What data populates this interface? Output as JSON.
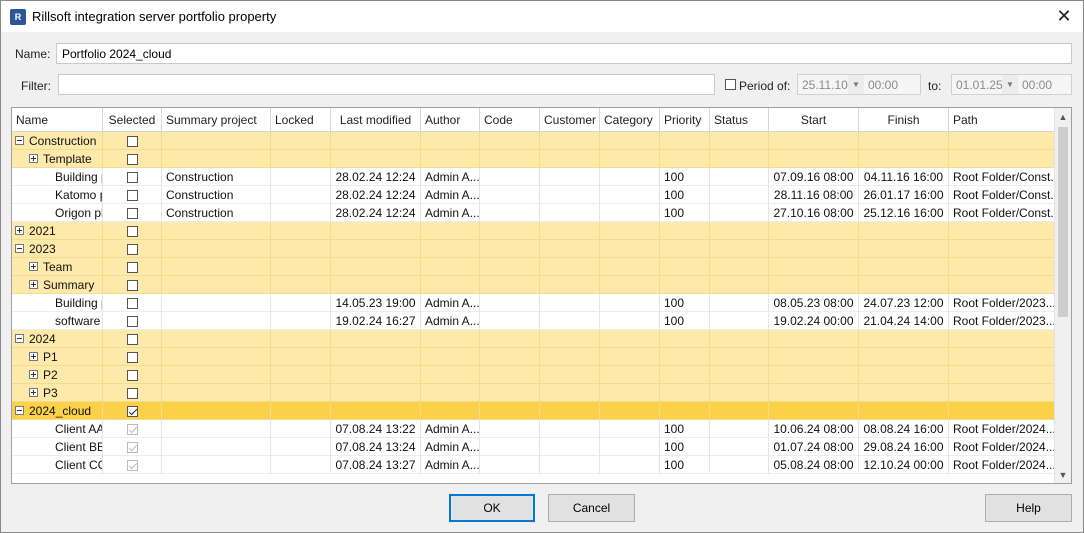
{
  "window": {
    "app_icon_text": "R",
    "title": "Rillsoft integration server portfolio property",
    "close_glyph": "✕"
  },
  "form": {
    "name_label": "Name:",
    "name_value": "Portfolio 2024_cloud",
    "filter_label": "Filter:",
    "filter_value": "",
    "period_label": "Period of:",
    "period_checked": false,
    "from_date": "25.11.10",
    "from_time": "00:00",
    "to_label": "to:",
    "to_date": "01.01.25",
    "to_time": "00:00"
  },
  "grid": {
    "columns": [
      "Name",
      "Selected",
      "Summary project",
      "Locked",
      "Last modified",
      "Author",
      "Code",
      "Customer",
      "Category",
      "Priority",
      "Status",
      "Start",
      "Finish",
      "Path"
    ],
    "rows": [
      {
        "type": "group",
        "level": 0,
        "expander": "minus",
        "name": "Construction",
        "checked": false,
        "disabled": false,
        "summary": "",
        "modified": "",
        "author": "",
        "priority": "",
        "start": "",
        "finish": "",
        "path": ""
      },
      {
        "type": "group",
        "level": 1,
        "expander": "plus",
        "name": "Template",
        "checked": false,
        "disabled": false,
        "summary": "",
        "modified": "",
        "author": "",
        "priority": "",
        "start": "",
        "finish": "",
        "path": ""
      },
      {
        "type": "plain",
        "level": 2,
        "expander": "",
        "name": "Building p",
        "checked": false,
        "disabled": false,
        "summary": "Construction",
        "modified": "28.02.24 12:24",
        "author": "Admin A...",
        "priority": "100",
        "start": "07.09.16 08:00",
        "finish": "04.11.16 16:00",
        "path": "Root Folder/Const..."
      },
      {
        "type": "plain",
        "level": 2,
        "expander": "",
        "name": "Katomo p",
        "checked": false,
        "disabled": false,
        "summary": "Construction",
        "modified": "28.02.24 12:24",
        "author": "Admin A...",
        "priority": "100",
        "start": "28.11.16 08:00",
        "finish": "26.01.17 16:00",
        "path": "Root Folder/Const..."
      },
      {
        "type": "plain",
        "level": 2,
        "expander": "",
        "name": "Origon pl",
        "checked": false,
        "disabled": false,
        "summary": "Construction",
        "modified": "28.02.24 12:24",
        "author": "Admin A...",
        "priority": "100",
        "start": "27.10.16 08:00",
        "finish": "25.12.16 16:00",
        "path": "Root Folder/Const..."
      },
      {
        "type": "group",
        "level": 0,
        "expander": "plus",
        "name": "2021",
        "checked": false,
        "disabled": false,
        "summary": "",
        "modified": "",
        "author": "",
        "priority": "",
        "start": "",
        "finish": "",
        "path": ""
      },
      {
        "type": "group",
        "level": 0,
        "expander": "minus",
        "name": "2023",
        "checked": false,
        "disabled": false,
        "summary": "",
        "modified": "",
        "author": "",
        "priority": "",
        "start": "",
        "finish": "",
        "path": ""
      },
      {
        "type": "group",
        "level": 1,
        "expander": "plus",
        "name": "Team",
        "checked": false,
        "disabled": false,
        "summary": "",
        "modified": "",
        "author": "",
        "priority": "",
        "start": "",
        "finish": "",
        "path": ""
      },
      {
        "type": "group",
        "level": 1,
        "expander": "plus",
        "name": "Summary",
        "checked": false,
        "disabled": false,
        "summary": "",
        "modified": "",
        "author": "",
        "priority": "",
        "start": "",
        "finish": "",
        "path": ""
      },
      {
        "type": "plain",
        "level": 2,
        "expander": "",
        "name": "Building p",
        "checked": false,
        "disabled": false,
        "summary": "",
        "modified": "14.05.23 19:00",
        "author": "Admin A...",
        "priority": "100",
        "start": "08.05.23 08:00",
        "finish": "24.07.23 12:00",
        "path": "Root Folder/2023..."
      },
      {
        "type": "plain",
        "level": 2,
        "expander": "",
        "name": "software",
        "checked": false,
        "disabled": false,
        "summary": "",
        "modified": "19.02.24 16:27",
        "author": "Admin A...",
        "priority": "100",
        "start": "19.02.24 00:00",
        "finish": "21.04.24 14:00",
        "path": "Root Folder/2023..."
      },
      {
        "type": "group",
        "level": 0,
        "expander": "minus",
        "name": "2024",
        "checked": false,
        "disabled": false,
        "summary": "",
        "modified": "",
        "author": "",
        "priority": "",
        "start": "",
        "finish": "",
        "path": ""
      },
      {
        "type": "group",
        "level": 1,
        "expander": "plus",
        "name": "P1",
        "checked": false,
        "disabled": false,
        "summary": "",
        "modified": "",
        "author": "",
        "priority": "",
        "start": "",
        "finish": "",
        "path": ""
      },
      {
        "type": "group",
        "level": 1,
        "expander": "plus",
        "name": "P2",
        "checked": false,
        "disabled": false,
        "summary": "",
        "modified": "",
        "author": "",
        "priority": "",
        "start": "",
        "finish": "",
        "path": ""
      },
      {
        "type": "group",
        "level": 1,
        "expander": "plus",
        "name": "P3",
        "checked": false,
        "disabled": false,
        "summary": "",
        "modified": "",
        "author": "",
        "priority": "",
        "start": "",
        "finish": "",
        "path": ""
      },
      {
        "type": "sel",
        "level": 0,
        "expander": "minus",
        "name": "2024_cloud",
        "checked": true,
        "disabled": false,
        "summary": "",
        "modified": "",
        "author": "",
        "priority": "",
        "start": "",
        "finish": "",
        "path": ""
      },
      {
        "type": "plain",
        "level": 2,
        "expander": "",
        "name": "Client AA",
        "checked": true,
        "disabled": true,
        "summary": "",
        "modified": "07.08.24 13:22",
        "author": "Admin A...",
        "priority": "100",
        "start": "10.06.24 08:00",
        "finish": "08.08.24 16:00",
        "path": "Root Folder/2024..."
      },
      {
        "type": "plain",
        "level": 2,
        "expander": "",
        "name": "Client BB",
        "checked": true,
        "disabled": true,
        "summary": "",
        "modified": "07.08.24 13:24",
        "author": "Admin A...",
        "priority": "100",
        "start": "01.07.24 08:00",
        "finish": "29.08.24 16:00",
        "path": "Root Folder/2024..."
      },
      {
        "type": "plain",
        "level": 2,
        "expander": "",
        "name": "Client CC",
        "checked": true,
        "disabled": true,
        "summary": "",
        "modified": "07.08.24 13:27",
        "author": "Admin A...",
        "priority": "100",
        "start": "05.08.24 08:00",
        "finish": "12.10.24 00:00",
        "path": "Root Folder/2024..."
      }
    ]
  },
  "buttons": {
    "ok": "OK",
    "cancel": "Cancel",
    "help": "Help"
  },
  "icons": {
    "scroll_up": "▲",
    "scroll_down": "▼",
    "dropdown": "▼"
  }
}
